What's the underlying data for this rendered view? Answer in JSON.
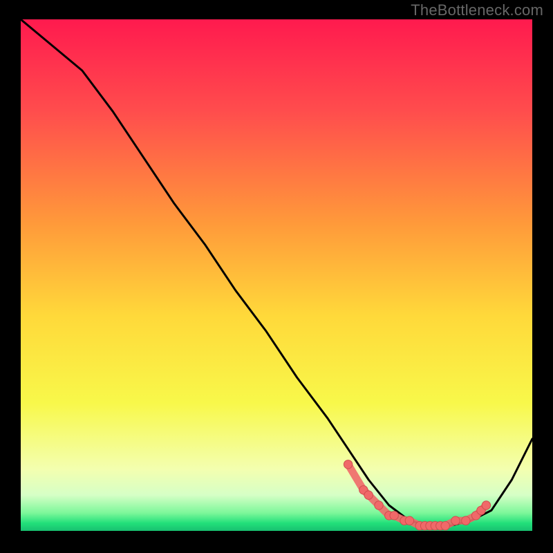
{
  "watermark": "TheBottleneck.com",
  "colors": {
    "gradient_stops": [
      {
        "offset": 0.0,
        "color": "#ff1a4e"
      },
      {
        "offset": 0.18,
        "color": "#ff4d4d"
      },
      {
        "offset": 0.4,
        "color": "#ff9a3a"
      },
      {
        "offset": 0.58,
        "color": "#ffd93a"
      },
      {
        "offset": 0.75,
        "color": "#f8f84a"
      },
      {
        "offset": 0.88,
        "color": "#f3ffb0"
      },
      {
        "offset": 0.93,
        "color": "#d6ffc6"
      },
      {
        "offset": 0.965,
        "color": "#7cf79a"
      },
      {
        "offset": 0.985,
        "color": "#22e07a"
      },
      {
        "offset": 1.0,
        "color": "#18c070"
      }
    ],
    "curve": "#000000",
    "marker_fill": "#f06969",
    "marker_stroke": "#cf4e4e"
  },
  "chart_data": {
    "type": "line",
    "title": "",
    "xlabel": "",
    "ylabel": "",
    "xlim": [
      0,
      100
    ],
    "ylim": [
      0,
      100
    ],
    "grid": false,
    "legend": false,
    "series": [
      {
        "name": "bottleneck-curve",
        "x": [
          0,
          6,
          12,
          18,
          24,
          30,
          36,
          42,
          48,
          54,
          60,
          64,
          68,
          72,
          76,
          80,
          84,
          88,
          92,
          96,
          100
        ],
        "y": [
          100,
          95,
          90,
          82,
          73,
          64,
          56,
          47,
          39,
          30,
          22,
          16,
          10,
          5,
          2,
          1,
          1,
          2,
          4,
          10,
          18
        ]
      }
    ],
    "markers": {
      "name": "highlight-points",
      "x": [
        64,
        67,
        68,
        70,
        72,
        73,
        75,
        76,
        78,
        79,
        80,
        81,
        82,
        83,
        85,
        87,
        89,
        90,
        91
      ],
      "y": [
        13,
        8,
        7,
        5,
        3,
        3,
        2,
        2,
        1,
        1,
        1,
        1,
        1,
        1,
        2,
        2,
        3,
        4,
        5
      ]
    }
  }
}
